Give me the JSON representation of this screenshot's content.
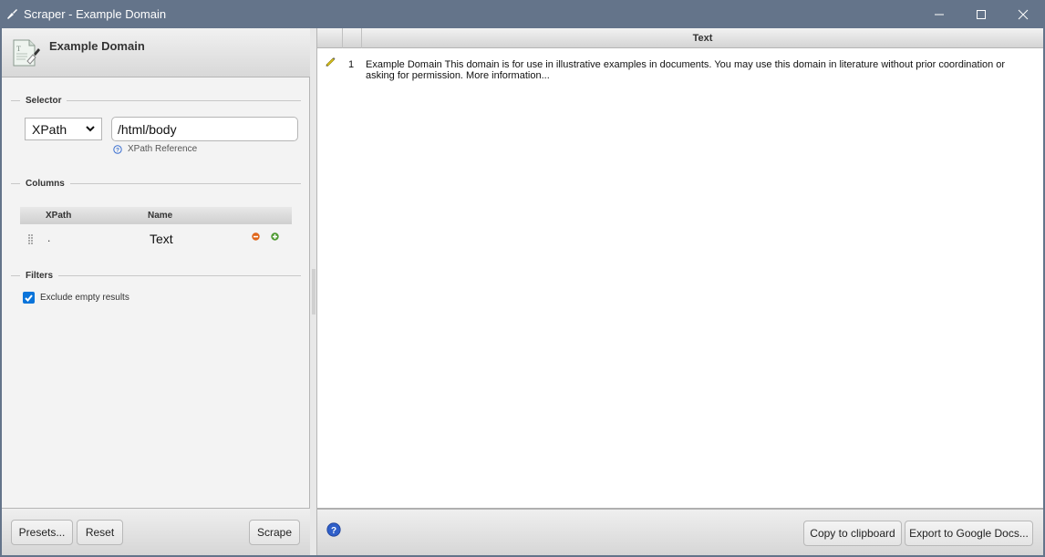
{
  "window": {
    "title": "Scraper - Example Domain",
    "controls": [
      "minimize",
      "maximize",
      "close"
    ]
  },
  "left_panel": {
    "heading": "Example Domain",
    "selector": {
      "section_label": "Selector",
      "type_value": "XPath",
      "input_value": "/html/body",
      "reference_link": "XPath Reference"
    },
    "columns": {
      "section_label": "Columns",
      "headers": [
        "XPath",
        "Name"
      ],
      "rows": [
        {
          "xpath": ".",
          "name": "Text"
        }
      ]
    },
    "filters": {
      "section_label": "Filters",
      "exclude_empty_label": "Exclude empty results",
      "exclude_empty_checked": true
    },
    "footer": {
      "presets_label": "Presets...",
      "reset_label": "Reset",
      "scrape_label": "Scrape"
    }
  },
  "results": {
    "columns": [
      "",
      "",
      "Text"
    ],
    "rows": [
      {
        "index": "1",
        "text": "Example Domain This domain is for use in illustrative examples in documents. You may use this domain in literature without prior coordination or asking for permission. More information..."
      }
    ],
    "footer": {
      "copy_label": "Copy to clipboard",
      "export_label": "Export to Google Docs..."
    }
  },
  "colors": {
    "titlebar": "#64748a",
    "checkbox": "#0a74da",
    "remove": "#e0661a",
    "add": "#4f9a32",
    "help": "#2f5fc9"
  }
}
